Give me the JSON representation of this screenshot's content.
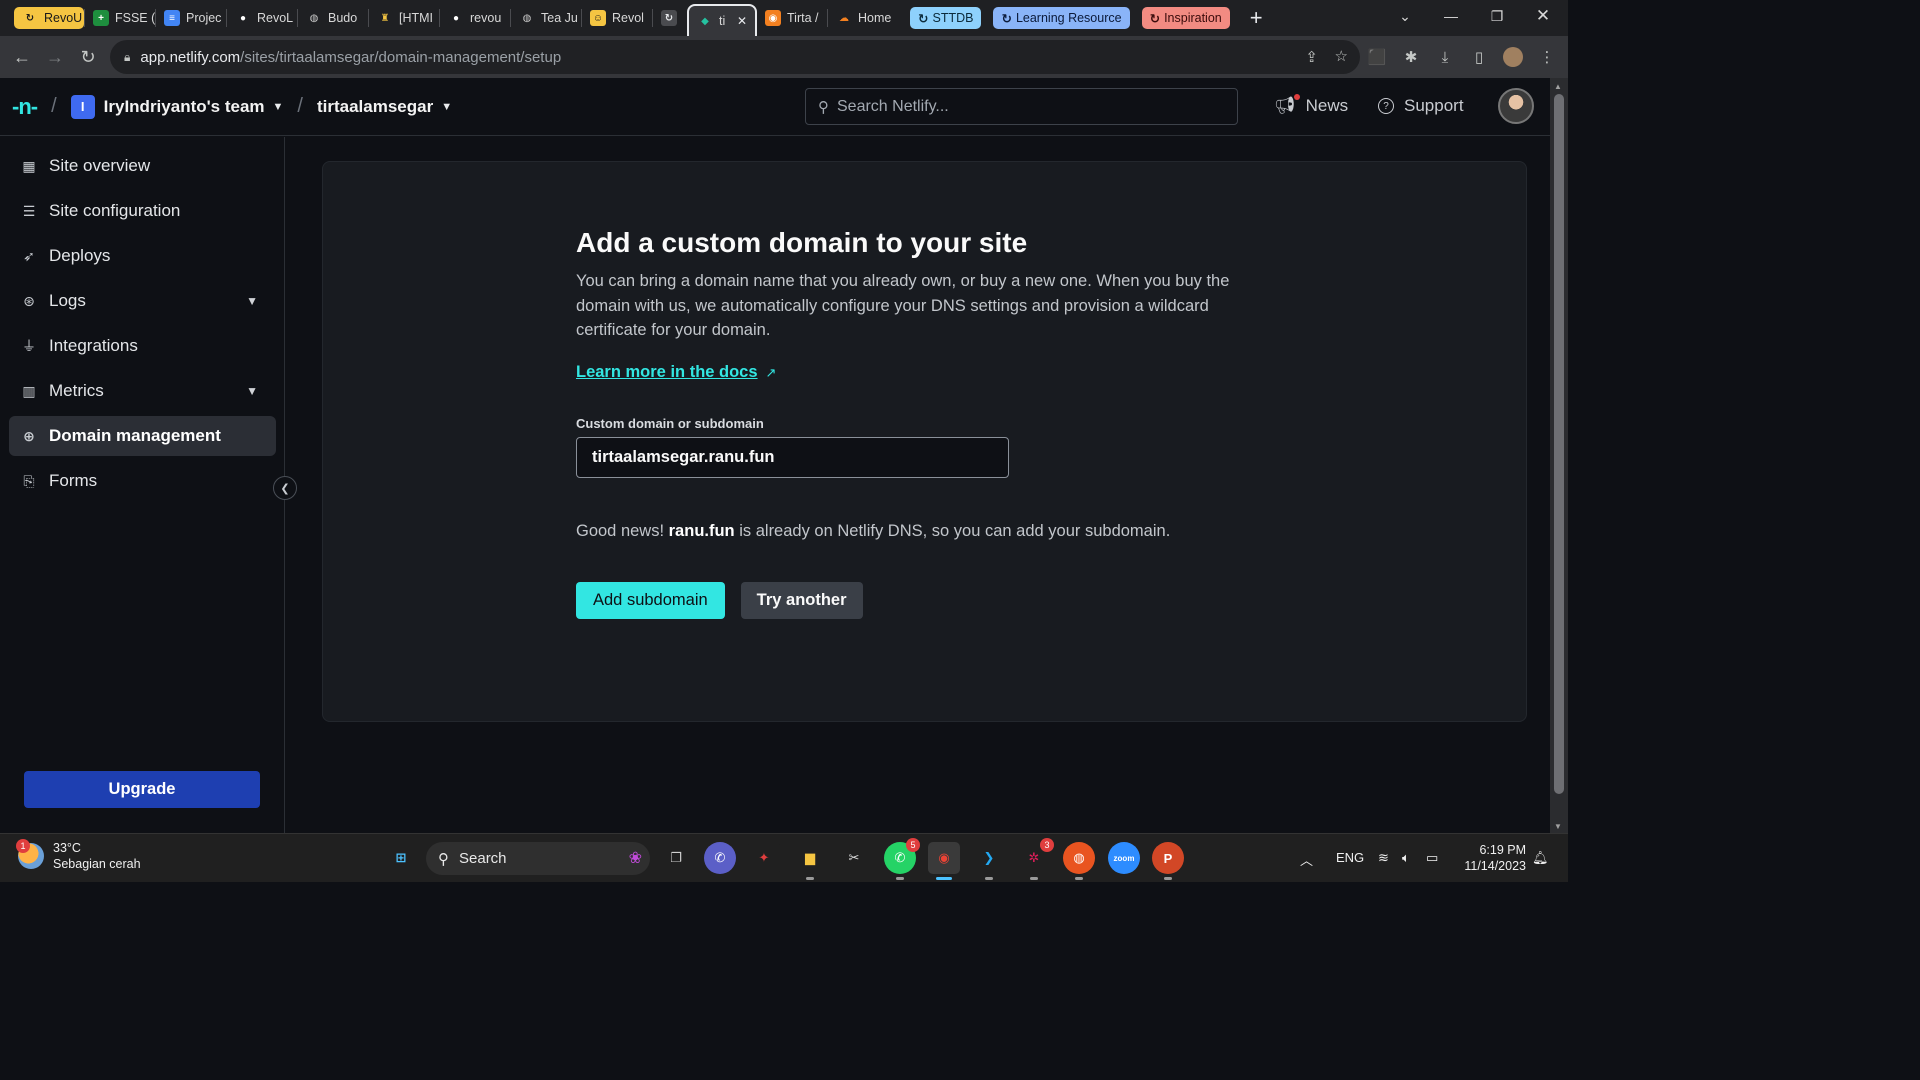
{
  "browser": {
    "tabs": [
      {
        "label": "RevoU",
        "fav": "↻",
        "fav_color": "#1a1a1a",
        "fav_bg": "#f5c542",
        "chip": "#f5c542"
      },
      {
        "label": "FSSE (",
        "fav": "+",
        "fav_color": "#ffffff",
        "fav_bg": "#1e8e3e"
      },
      {
        "label": "Projec",
        "fav": "≡",
        "fav_color": "#ffffff",
        "fav_bg": "#4285f4"
      },
      {
        "label": "RevoL",
        "fav": "●",
        "fav_color": "#ffffff",
        "fav_bg": "#1f2023"
      },
      {
        "label": "Budo",
        "fav": "◍",
        "fav_color": "#cccccc",
        "fav_bg": "#1f2023"
      },
      {
        "label": "[HTMI",
        "fav": "♜",
        "fav_color": "#f5c542",
        "fav_bg": "#1f2023"
      },
      {
        "label": "revou",
        "fav": "●",
        "fav_color": "#ffffff",
        "fav_bg": "#1f2023"
      },
      {
        "label": "Tea Ju",
        "fav": "◍",
        "fav_color": "#cccccc",
        "fav_bg": "#1f2023"
      },
      {
        "label": "Revol",
        "fav": "☺",
        "fav_color": "#1a1a1a",
        "fav_bg": "#f5c542"
      },
      {
        "label": "",
        "fav": "↻",
        "fav_color": "#e8eaed",
        "fav_bg": "#4a4b4f"
      },
      {
        "label": "ti",
        "fav": "◆",
        "fav_color": "#25c2a0",
        "fav_bg": "#35363a",
        "active": true
      },
      {
        "label": "Tirta /",
        "fav": "◉",
        "fav_color": "#ffffff",
        "fav_bg": "#f38020"
      },
      {
        "label": "Home",
        "fav": "☁",
        "fav_color": "#f38020",
        "fav_bg": "#1f2023"
      }
    ],
    "groups": [
      {
        "label": "STTDB",
        "bg": "#8ed1fc",
        "fg": "#0b2a3a"
      },
      {
        "label": "Learning Resource",
        "bg": "#8ab4f8",
        "fg": "#0b1a3a"
      },
      {
        "label": "Inspiration",
        "bg": "#f28b82",
        "fg": "#3a0b0b"
      }
    ],
    "new_tab": "+",
    "address": {
      "host": "app.netlify.com",
      "path": "/sites/tirtaalamsegar/domain-management/setup"
    }
  },
  "header": {
    "logo": "-n-",
    "team_initial": "I",
    "team": "IryIndriyanto's team",
    "site": "tirtaalamsegar",
    "search_placeholder": "Search Netlify...",
    "news": "News",
    "support": "Support"
  },
  "sidebar": {
    "items": [
      {
        "label": "Site overview",
        "icon": "grid-icon",
        "glyph": "▦"
      },
      {
        "label": "Site configuration",
        "icon": "sliders-icon",
        "glyph": "☰"
      },
      {
        "label": "Deploys",
        "icon": "rocket-icon",
        "glyph": "➶"
      },
      {
        "label": "Logs",
        "icon": "logs-icon",
        "glyph": "⊛",
        "has_caret": true
      },
      {
        "label": "Integrations",
        "icon": "plug-icon",
        "glyph": "⏚"
      },
      {
        "label": "Metrics",
        "icon": "bar-chart-icon",
        "glyph": "▥",
        "has_caret": true
      },
      {
        "label": "Domain management",
        "icon": "globe-icon",
        "glyph": "⊕",
        "active": true
      },
      {
        "label": "Forms",
        "icon": "forms-icon",
        "glyph": "⎘"
      }
    ],
    "upgrade": "Upgrade"
  },
  "main": {
    "title": "Add a custom domain to your site",
    "description": "You can bring a domain name that you already own, or buy a new one. When you buy the domain with us, we automatically configure your DNS settings and provision a wildcard certificate for your domain.",
    "docs_link": "Learn more in the docs",
    "docs_arrow": "↗",
    "field_label": "Custom domain or subdomain",
    "field_value": "tirtaalamsegar.ranu.fun",
    "good_news_prefix": "Good news! ",
    "good_news_domain": "ranu.fun",
    "good_news_suffix": " is already on Netlify DNS, so you can add your subdomain.",
    "primary_button": "Add subdomain",
    "secondary_button": "Try another"
  },
  "taskbar": {
    "weather_temp": "33°C",
    "weather_desc": "Sebagian cerah",
    "weather_badge": "1",
    "search": "Search",
    "apps": [
      {
        "name": "windows-start-icon",
        "glyph": "⊞",
        "bg": "#202020",
        "fg": "#4cc2ff"
      },
      {
        "name": "task-view-icon",
        "glyph": "❐",
        "bg": "#202020",
        "fg": "#d0d0d0"
      },
      {
        "name": "teams-chat-icon",
        "glyph": "✆",
        "bg": "#5b5fc7",
        "fg": "#ffffff"
      },
      {
        "name": "app-red-icon",
        "glyph": "✦",
        "bg": "#202020",
        "fg": "#e03e3e"
      },
      {
        "name": "file-explorer-icon",
        "glyph": "▆",
        "bg": "#202020",
        "fg": "#f5c542",
        "running": true
      },
      {
        "name": "snipping-tool-icon",
        "glyph": "✂",
        "bg": "#202020",
        "fg": "#e0e0e0"
      },
      {
        "name": "whatsapp-icon",
        "glyph": "✆",
        "bg": "#25d366",
        "fg": "#ffffff",
        "badge": "5",
        "running": true
      },
      {
        "name": "chrome-icon",
        "glyph": "◉",
        "bg": "#202020",
        "fg": "#ea4335",
        "running": true,
        "active": true
      },
      {
        "name": "vscode-icon",
        "glyph": "❯",
        "bg": "#202020",
        "fg": "#23a9f2",
        "running": true
      },
      {
        "name": "slack-icon",
        "glyph": "✲",
        "bg": "#202020",
        "fg": "#e01e5a",
        "badge": "3",
        "running": true
      },
      {
        "name": "ubuntu-icon",
        "glyph": "◍",
        "bg": "#e95420",
        "fg": "#ffffff",
        "running": true
      },
      {
        "name": "zoom-icon",
        "glyph": "zoom",
        "bg": "#2d8cff",
        "fg": "#ffffff"
      },
      {
        "name": "powerpoint-icon",
        "glyph": "P",
        "bg": "#d24726",
        "fg": "#ffffff",
        "running": true
      }
    ],
    "lang": "ENG",
    "time": "6:19 PM",
    "date": "11/14/2023"
  }
}
